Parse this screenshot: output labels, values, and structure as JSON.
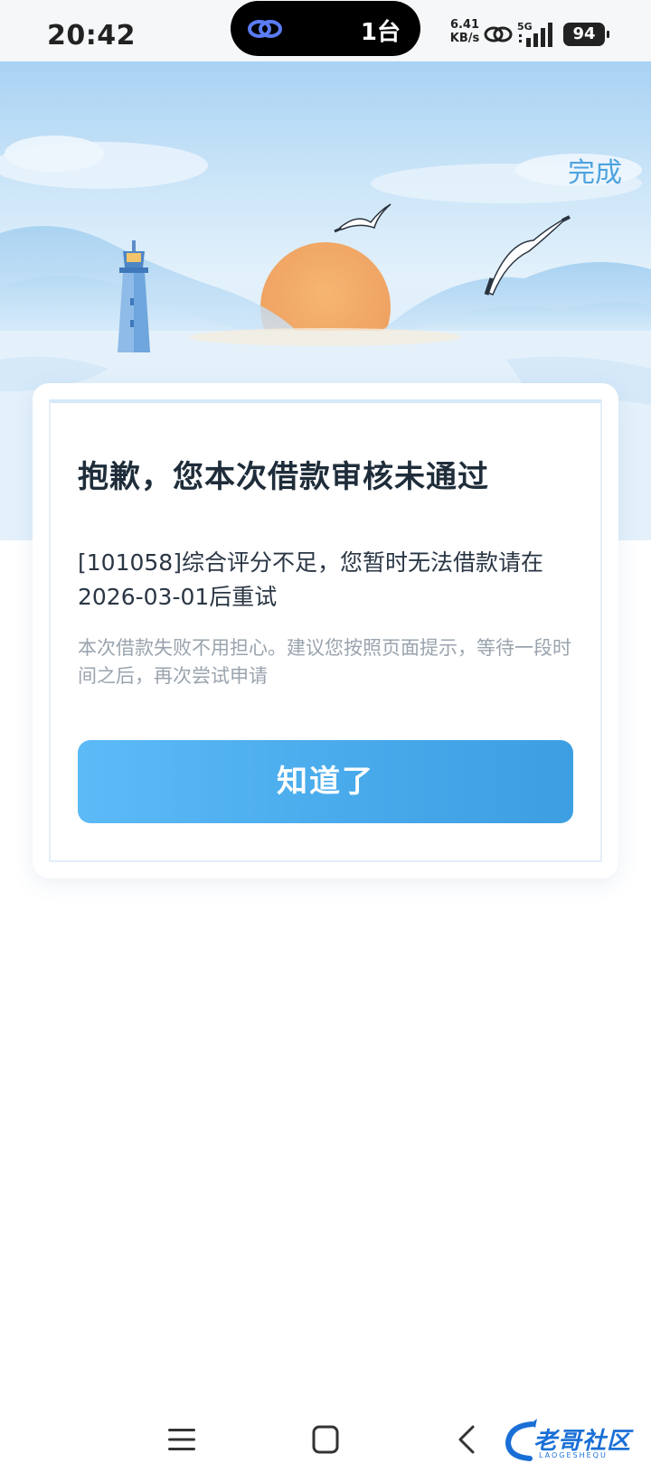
{
  "status_bar": {
    "time": "20:42",
    "pill_text": "1台",
    "net_speed_value": "6.41",
    "net_speed_unit": "KB/s",
    "network_type": "5G",
    "battery": "94"
  },
  "header": {
    "done_label": "完成"
  },
  "card": {
    "title": "抱歉，您本次借款审核未通过",
    "message": "[101058]综合评分不足，您暂时无法借款请在2026-03-01后重试",
    "tip": "本次借款失败不用担心。建议您按照页面提示，等待一段时间之后，再次尝试申请",
    "button_label": "知道了"
  },
  "watermark": {
    "text": "老哥社区",
    "sub": "LAOGESHEQU"
  },
  "colors": {
    "accent": "#4ea3df",
    "button_start": "#5cbaf7",
    "button_end": "#3d9fe2",
    "sun": "#f2a867"
  }
}
